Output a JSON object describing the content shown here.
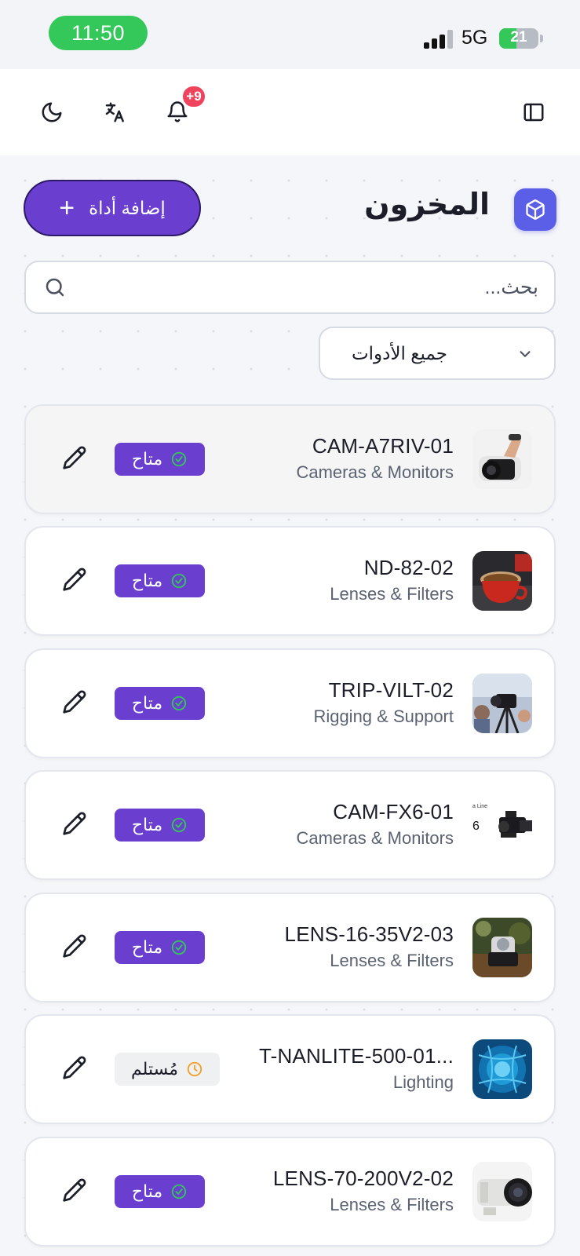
{
  "status_bar": {
    "time": "11:50",
    "network": "5G",
    "battery": "21"
  },
  "header": {
    "notification_count": "+9",
    "icons": [
      "moon-icon",
      "translate-icon",
      "bell-icon",
      "sidebar-toggle-icon"
    ]
  },
  "page": {
    "title": "المخزون",
    "add_button_label": "إضافة أداة",
    "search_placeholder": "بحث...",
    "filter_selected": "جميع الأدوات"
  },
  "colors": {
    "primary": "#6a3fd0",
    "badge_blue": "#5b5ee6",
    "notification": "#f0435e",
    "status_green": "#34c759",
    "pending_orange": "#f0a028"
  },
  "items": [
    {
      "code": "CAM-A7RIV-01",
      "category": "Cameras & Monitors",
      "status": "متاح",
      "status_type": "available",
      "thumbnail": "camera-with-hand"
    },
    {
      "code": "ND-82-02",
      "category": "Lenses & Filters",
      "status": "متاح",
      "status_type": "available",
      "thumbnail": "coffee-cup"
    },
    {
      "code": "TRIP-VILT-02",
      "category": "Rigging & Support",
      "status": "متاح",
      "status_type": "available",
      "thumbnail": "tripod-camera"
    },
    {
      "code": "CAM-FX6-01",
      "category": "Cameras & Monitors",
      "status": "متاح",
      "status_type": "available",
      "thumbnail": "cinema-camera"
    },
    {
      "code": "LENS-16-35V2-03",
      "category": "Lenses & Filters",
      "status": "متاح",
      "status_type": "available",
      "thumbnail": "lens-on-table"
    },
    {
      "code": "T-NANLITE-500-01...",
      "category": "Lighting",
      "status": "مُستلم",
      "status_type": "received",
      "thumbnail": "blue-light"
    },
    {
      "code": "LENS-70-200V2-02",
      "category": "Lenses & Filters",
      "status": "متاح",
      "status_type": "available",
      "thumbnail": "zoom-lens"
    }
  ]
}
